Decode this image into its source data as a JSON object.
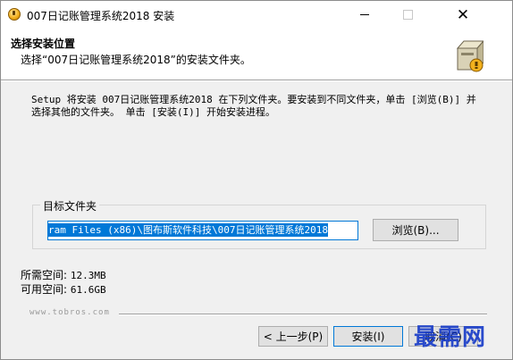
{
  "window": {
    "title": "007日记账管理系统2018 安装",
    "minimize_glyph": "—",
    "close_glyph": "✕"
  },
  "header": {
    "title": "选择安装位置",
    "subtitle": "选择“007日记账管理系统2018”的安装文件夹。",
    "icon": "installer-box-icon"
  },
  "intro_text": "Setup 将安装 007日记账管理系统2018 在下列文件夹。要安装到不同文件夹，单击 [浏览(B)] 并选择其他的文件夹。 单击 [安装(I)] 开始安装进程。",
  "destination": {
    "group_label": "目标文件夹",
    "path_value": "ram Files (x86)\\图布斯软件科技\\007日记账管理系统2018",
    "browse_label": "浏览(B)..."
  },
  "space": {
    "required_label": "所需空间:",
    "required_value": "12.3MB",
    "available_label": "可用空间:",
    "available_value": "61.6GB"
  },
  "branding": "www.tobros.com",
  "buttons": {
    "back_label": "< 上一步(P)",
    "install_label": "安装(I)",
    "cancel_label": "取消(C)"
  },
  "watermark": "最需网",
  "colors": {
    "accent": "#0078d7",
    "window_bg": "#f0f0f0",
    "watermark": "#1a3ec9"
  }
}
